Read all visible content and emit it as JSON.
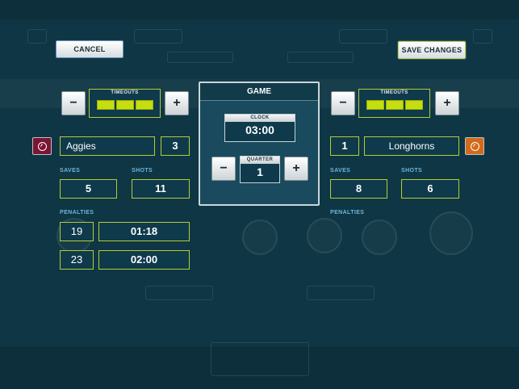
{
  "toolbar": {
    "cancel_label": "CANCEL",
    "save_label": "SAVE CHANGES"
  },
  "home": {
    "timeouts_label": "TIMEOUTS",
    "timeouts_total": 3,
    "team_name": "Aggies",
    "score": "3",
    "saves_label": "SAVES",
    "saves": "5",
    "shots_label": "SHOTS",
    "shots": "11",
    "penalties_label": "PENALTIES",
    "penalties": [
      {
        "number": "19",
        "time": "01:18"
      },
      {
        "number": "23",
        "time": "02:00"
      }
    ],
    "color": "#7b1535"
  },
  "away": {
    "timeouts_label": "TIMEOUTS",
    "timeouts_total": 3,
    "team_name": "Longhorns",
    "score": "1",
    "saves_label": "SAVES",
    "saves": "8",
    "shots_label": "SHOTS",
    "shots": "6",
    "penalties_label": "PENALTIES",
    "color": "#d36a1b"
  },
  "game": {
    "title": "GAME",
    "clock_label": "CLOCK",
    "clock": "03:00",
    "quarter_label": "QUARTER",
    "quarter": "1"
  },
  "colors": {
    "accent": "#b4cd35",
    "background": "#0f3644",
    "label": "#6fb6dc"
  }
}
